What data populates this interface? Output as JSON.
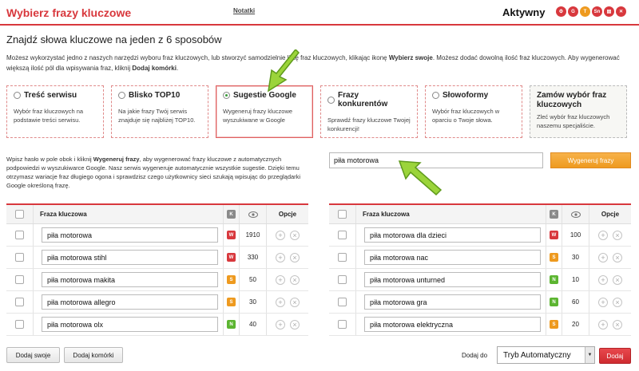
{
  "header": {
    "title": "Wybierz frazy kluczowe",
    "notes_link": "Notatki",
    "status": "Aktywny",
    "icons": [
      {
        "name": "gear-icon",
        "glyph": "⚙",
        "color": "#d8383d"
      },
      {
        "name": "google-icon",
        "glyph": "G",
        "color": "#d8383d"
      },
      {
        "name": "t-icon",
        "glyph": "T",
        "color": "#ee9a1f"
      },
      {
        "name": "sn-icon",
        "glyph": "Sn",
        "color": "#d8383d"
      },
      {
        "name": "document-icon",
        "glyph": "▤",
        "color": "#d8383d"
      },
      {
        "name": "close-icon",
        "glyph": "✕",
        "color": "#d8383d"
      }
    ]
  },
  "main": {
    "heading": "Znajdź słowa kluczowe na jeden z 6 sposobów",
    "intro_part1": "Możesz wykorzystać jedno z naszych narzędzi wyboru fraz kluczowych, lub stworzyć samodzielnie listę fraz kluczowych, klikając ikonę ",
    "intro_bold1": "Wybierz swoje",
    "intro_part2": ". Możesz dodać dowolną ilość fraz kluczowych. Aby wygenerować większą ilość pól dla wpisywania fraz, kliknij ",
    "intro_bold2": "Dodaj komórki",
    "intro_part3": "."
  },
  "methods": [
    {
      "title": "Treść serwisu",
      "desc": "Wybór fraz kluczowych na podstawie treści serwisu.",
      "selected": false
    },
    {
      "title": "Blisko TOP10",
      "desc": "Na jakie frazy Twój serwis znajduje się najbliżej TOP10.",
      "selected": false
    },
    {
      "title": "Sugestie Google",
      "desc": "Wygeneruj frazy kluczowe wyszukiwane w Google",
      "selected": true
    },
    {
      "title": "Frazy konkurentów",
      "desc": "Sprawdź frazy kluczowe Twojej konkurencji!",
      "selected": false
    },
    {
      "title": "Słowoformy",
      "desc": "Wybór fraz kluczowych w oparciu o Twoje słowa.",
      "selected": false
    },
    {
      "title": "Zamów wybór fraz kluczowych",
      "desc": "Zleć wybór fraz kluczowych naszemu specjaliście."
    }
  ],
  "help": {
    "part1": "Wpisz hasło w pole obok i kliknij ",
    "bold": "Wygeneruj frazy",
    "part2": ", aby wygenerować frazy kluczowe z automatycznych podpowiedzi w wyszukiwarce Google. Nasz serwis wygeneruje automatycznie wszystkie sugestie. Dzięki temu otrzymasz wariacje fraz długiego ogona i sprawdzisz czego użytkownicy sieci szukają wpisując do przeglądarki Google określoną frazę."
  },
  "search": {
    "value": "piła motorowa",
    "button": "Wygeneruj frazy"
  },
  "table_headers": {
    "keyword": "Fraza kluczowa",
    "k": "K",
    "options": "Opcje"
  },
  "colors": {
    "accent": "#d8383d",
    "W": "#d8383d",
    "S": "#ee9a1f",
    "N": "#5cb531"
  },
  "left_rows": [
    {
      "keyword": "piła motorowa",
      "badge": "W",
      "volume": "1910"
    },
    {
      "keyword": "piła motorowa stihl",
      "badge": "W",
      "volume": "330"
    },
    {
      "keyword": "piła motorowa makita",
      "badge": "S",
      "volume": "50"
    },
    {
      "keyword": "piła motorowa allegro",
      "badge": "S",
      "volume": "30"
    },
    {
      "keyword": "piła motorowa olx",
      "badge": "N",
      "volume": "40"
    }
  ],
  "right_rows": [
    {
      "keyword": "piła motorowa dla dzieci",
      "badge": "W",
      "volume": "100"
    },
    {
      "keyword": "piła motorowa nac",
      "badge": "S",
      "volume": "30"
    },
    {
      "keyword": "piła motorowa unturned",
      "badge": "N",
      "volume": "10"
    },
    {
      "keyword": "piła motorowa gra",
      "badge": "N",
      "volume": "60"
    },
    {
      "keyword": "piła motorowa elektryczna",
      "badge": "S",
      "volume": "20"
    }
  ],
  "footer": {
    "add_own": "Dodaj swoje",
    "add_cells": "Dodaj komórki",
    "add_to_label": "Dodaj do",
    "mode_value": "Tryb Automatyczny",
    "add_button": "Dodaj"
  }
}
